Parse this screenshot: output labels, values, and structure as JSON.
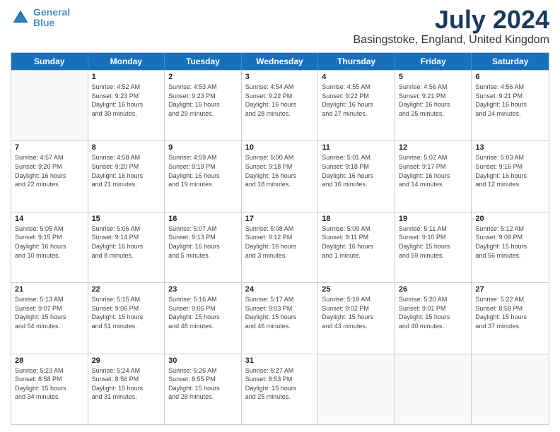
{
  "logo": {
    "line1": "General",
    "line2": "Blue"
  },
  "title": "July 2024",
  "location": "Basingstoke, England, United Kingdom",
  "weekdays": [
    "Sunday",
    "Monday",
    "Tuesday",
    "Wednesday",
    "Thursday",
    "Friday",
    "Saturday"
  ],
  "weeks": [
    [
      {
        "day": "",
        "info": ""
      },
      {
        "day": "1",
        "info": "Sunrise: 4:52 AM\nSunset: 9:23 PM\nDaylight: 16 hours\nand 30 minutes."
      },
      {
        "day": "2",
        "info": "Sunrise: 4:53 AM\nSunset: 9:23 PM\nDaylight: 16 hours\nand 29 minutes."
      },
      {
        "day": "3",
        "info": "Sunrise: 4:54 AM\nSunset: 9:22 PM\nDaylight: 16 hours\nand 28 minutes."
      },
      {
        "day": "4",
        "info": "Sunrise: 4:55 AM\nSunset: 9:22 PM\nDaylight: 16 hours\nand 27 minutes."
      },
      {
        "day": "5",
        "info": "Sunrise: 4:56 AM\nSunset: 9:21 PM\nDaylight: 16 hours\nand 25 minutes."
      },
      {
        "day": "6",
        "info": "Sunrise: 4:56 AM\nSunset: 9:21 PM\nDaylight: 16 hours\nand 24 minutes."
      }
    ],
    [
      {
        "day": "7",
        "info": "Sunrise: 4:57 AM\nSunset: 9:20 PM\nDaylight: 16 hours\nand 22 minutes."
      },
      {
        "day": "8",
        "info": "Sunrise: 4:58 AM\nSunset: 9:20 PM\nDaylight: 16 hours\nand 21 minutes."
      },
      {
        "day": "9",
        "info": "Sunrise: 4:59 AM\nSunset: 9:19 PM\nDaylight: 16 hours\nand 19 minutes."
      },
      {
        "day": "10",
        "info": "Sunrise: 5:00 AM\nSunset: 9:18 PM\nDaylight: 16 hours\nand 18 minutes."
      },
      {
        "day": "11",
        "info": "Sunrise: 5:01 AM\nSunset: 9:18 PM\nDaylight: 16 hours\nand 16 minutes."
      },
      {
        "day": "12",
        "info": "Sunrise: 5:02 AM\nSunset: 9:17 PM\nDaylight: 16 hours\nand 14 minutes."
      },
      {
        "day": "13",
        "info": "Sunrise: 5:03 AM\nSunset: 9:16 PM\nDaylight: 16 hours\nand 12 minutes."
      }
    ],
    [
      {
        "day": "14",
        "info": "Sunrise: 5:05 AM\nSunset: 9:15 PM\nDaylight: 16 hours\nand 10 minutes."
      },
      {
        "day": "15",
        "info": "Sunrise: 5:06 AM\nSunset: 9:14 PM\nDaylight: 16 hours\nand 8 minutes."
      },
      {
        "day": "16",
        "info": "Sunrise: 5:07 AM\nSunset: 9:13 PM\nDaylight: 16 hours\nand 5 minutes."
      },
      {
        "day": "17",
        "info": "Sunrise: 5:08 AM\nSunset: 9:12 PM\nDaylight: 16 hours\nand 3 minutes."
      },
      {
        "day": "18",
        "info": "Sunrise: 5:09 AM\nSunset: 9:11 PM\nDaylight: 16 hours\nand 1 minute."
      },
      {
        "day": "19",
        "info": "Sunrise: 5:11 AM\nSunset: 9:10 PM\nDaylight: 15 hours\nand 59 minutes."
      },
      {
        "day": "20",
        "info": "Sunrise: 5:12 AM\nSunset: 9:09 PM\nDaylight: 15 hours\nand 56 minutes."
      }
    ],
    [
      {
        "day": "21",
        "info": "Sunrise: 5:13 AM\nSunset: 9:07 PM\nDaylight: 15 hours\nand 54 minutes."
      },
      {
        "day": "22",
        "info": "Sunrise: 5:15 AM\nSunset: 9:06 PM\nDaylight: 15 hours\nand 51 minutes."
      },
      {
        "day": "23",
        "info": "Sunrise: 5:16 AM\nSunset: 9:05 PM\nDaylight: 15 hours\nand 48 minutes."
      },
      {
        "day": "24",
        "info": "Sunrise: 5:17 AM\nSunset: 9:03 PM\nDaylight: 15 hours\nand 46 minutes."
      },
      {
        "day": "25",
        "info": "Sunrise: 5:19 AM\nSunset: 9:02 PM\nDaylight: 15 hours\nand 43 minutes."
      },
      {
        "day": "26",
        "info": "Sunrise: 5:20 AM\nSunset: 9:01 PM\nDaylight: 15 hours\nand 40 minutes."
      },
      {
        "day": "27",
        "info": "Sunrise: 5:22 AM\nSunset: 8:59 PM\nDaylight: 15 hours\nand 37 minutes."
      }
    ],
    [
      {
        "day": "28",
        "info": "Sunrise: 5:23 AM\nSunset: 8:58 PM\nDaylight: 15 hours\nand 34 minutes."
      },
      {
        "day": "29",
        "info": "Sunrise: 5:24 AM\nSunset: 8:56 PM\nDaylight: 15 hours\nand 31 minutes."
      },
      {
        "day": "30",
        "info": "Sunrise: 5:26 AM\nSunset: 8:55 PM\nDaylight: 15 hours\nand 28 minutes."
      },
      {
        "day": "31",
        "info": "Sunrise: 5:27 AM\nSunset: 8:53 PM\nDaylight: 15 hours\nand 25 minutes."
      },
      {
        "day": "",
        "info": ""
      },
      {
        "day": "",
        "info": ""
      },
      {
        "day": "",
        "info": ""
      }
    ]
  ]
}
